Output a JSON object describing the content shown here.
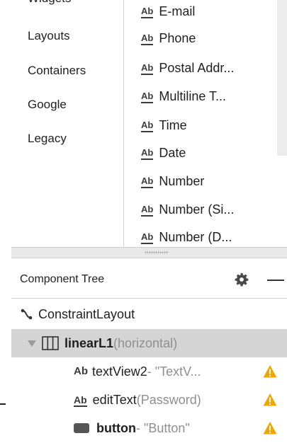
{
  "palette": {
    "categories": [
      {
        "label": "Widgets"
      },
      {
        "label": "Layouts"
      },
      {
        "label": "Containers"
      },
      {
        "label": "Google"
      },
      {
        "label": "Legacy"
      }
    ],
    "items": [
      {
        "label": "E-mail",
        "icon": "ab-underlined-icon"
      },
      {
        "label": "Phone",
        "icon": "ab-underlined-icon"
      },
      {
        "label": "Postal Addr...",
        "icon": "ab-underlined-icon"
      },
      {
        "label": "Multiline T...",
        "icon": "ab-underlined-icon"
      },
      {
        "label": "Time",
        "icon": "ab-underlined-icon"
      },
      {
        "label": "Date",
        "icon": "ab-underlined-icon"
      },
      {
        "label": "Number",
        "icon": "ab-underlined-icon"
      },
      {
        "label": "Number (Si...",
        "icon": "ab-underlined-icon"
      },
      {
        "label": "Number (D...",
        "icon": "ab-underlined-icon"
      }
    ],
    "ab_text": "Ab"
  },
  "component_tree": {
    "title": "Component Tree",
    "root": {
      "name": "ConstraintLayout"
    },
    "linear": {
      "name": "linearL1",
      "detail": "(horizontal)"
    },
    "children": [
      {
        "name": "textView2",
        "detail": "- \"TextV...",
        "icon": "ab-text-icon"
      },
      {
        "name": "editText",
        "detail": "(Password)",
        "icon": "ab-underlined-icon"
      },
      {
        "name": "button",
        "detail": "- \"Button\"",
        "icon": "button-icon"
      }
    ]
  },
  "colors": {
    "warning": "#f0a800",
    "selection": "#d5d5d5"
  }
}
